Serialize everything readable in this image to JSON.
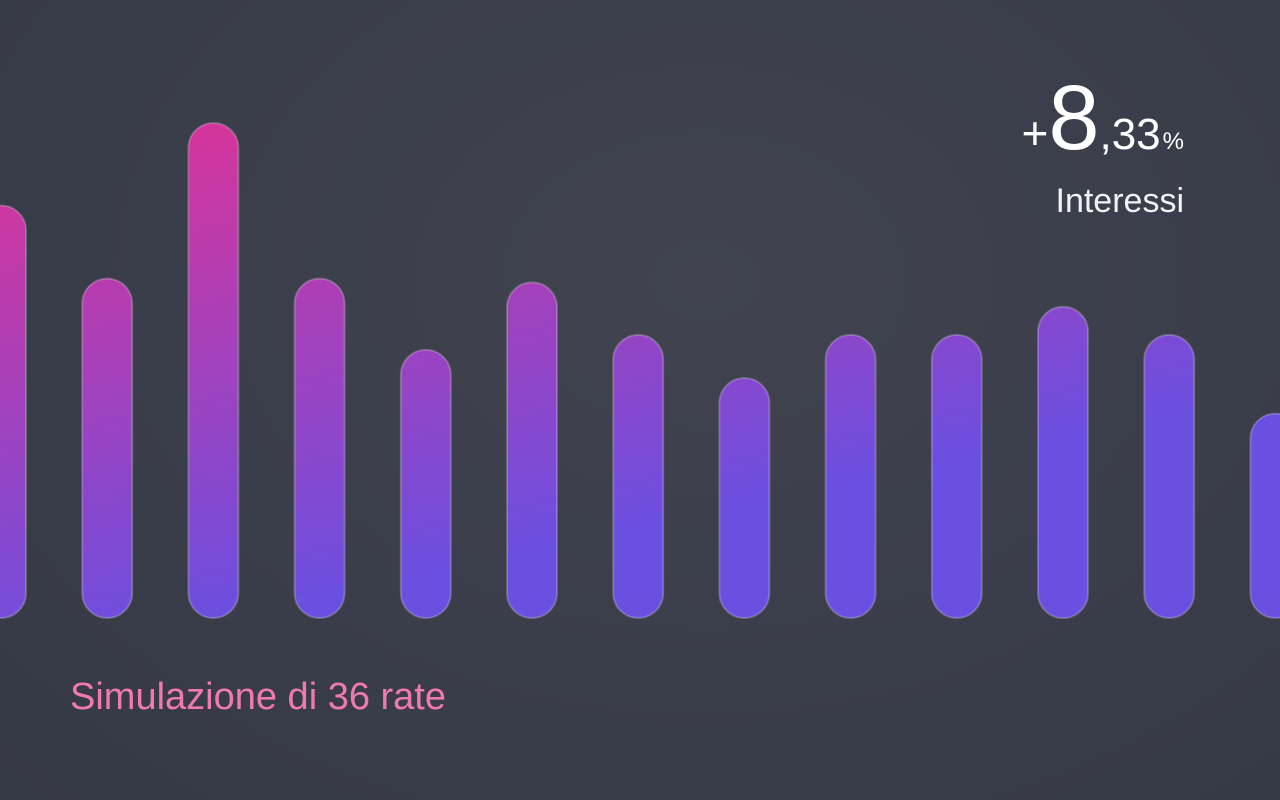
{
  "kpi": {
    "sign": "+",
    "integer": "8",
    "decimal": ",33",
    "unit": "%",
    "label": "Interessi"
  },
  "caption": "Simulazione di 36 rate",
  "colors": {
    "background": "#3a3d4b",
    "bar_top": "#e8308f",
    "bar_bottom": "#6b4fe0",
    "caption": "#f07ab0",
    "kpi_text": "#ffffff"
  },
  "chart_data": {
    "type": "bar",
    "values": [
      440,
      362,
      528,
      362,
      286,
      358,
      302,
      256,
      302,
      302,
      332,
      302,
      218
    ],
    "ylim": [
      0,
      640
    ]
  }
}
